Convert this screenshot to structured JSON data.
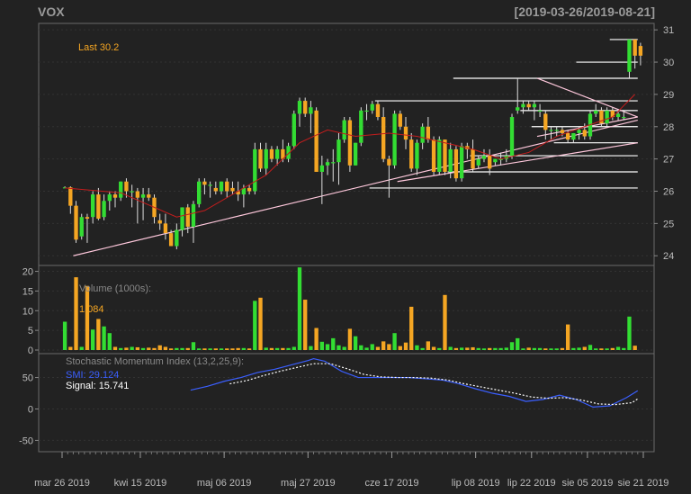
{
  "header": {
    "title": "VOX",
    "range": "[2019-03-26/2019-08-21]"
  },
  "chart_data": [
    {
      "type": "candlestick",
      "panel": "price",
      "last_label": "Last 30.2",
      "ylim": [
        23.7,
        31.2
      ],
      "yticks": [
        24,
        25,
        26,
        27,
        28,
        29,
        30,
        31
      ],
      "up_color": "#33dd33",
      "down_color": "#f5a623",
      "trading_days": 104,
      "ohlc": [
        [
          26.1,
          26.15,
          26.1,
          26.12
        ],
        [
          26.12,
          26.15,
          25.3,
          25.55
        ],
        [
          25.55,
          25.7,
          24.4,
          24.5
        ],
        [
          24.6,
          25.3,
          24.5,
          25.2
        ],
        [
          25.2,
          25.3,
          24.4,
          25.15
        ],
        [
          25.2,
          26.0,
          25.0,
          25.9
        ],
        [
          25.9,
          26.1,
          25.1,
          25.15
        ],
        [
          25.2,
          25.9,
          25.1,
          25.7
        ],
        [
          25.7,
          26.0,
          25.4,
          25.9
        ],
        [
          25.9,
          26.0,
          25.5,
          25.8
        ],
        [
          25.8,
          26.3,
          25.7,
          26.3
        ],
        [
          26.3,
          26.4,
          25.8,
          26.0
        ],
        [
          26.0,
          26.2,
          25.5,
          26.0
        ],
        [
          26.0,
          26.1,
          25.0,
          25.8
        ],
        [
          25.8,
          26.1,
          25.1,
          25.9
        ],
        [
          25.9,
          26.1,
          25.7,
          25.8
        ],
        [
          25.8,
          25.9,
          25.0,
          25.2
        ],
        [
          25.1,
          25.3,
          24.8,
          25.0
        ],
        [
          25.0,
          25.3,
          24.5,
          24.7
        ],
        [
          24.7,
          24.8,
          24.3,
          24.3
        ],
        [
          24.3,
          25.0,
          24.2,
          24.8
        ],
        [
          24.8,
          25.5,
          24.6,
          25.5
        ],
        [
          25.5,
          25.6,
          24.7,
          24.9
        ],
        [
          24.9,
          25.7,
          24.4,
          25.6
        ],
        [
          25.6,
          26.4,
          25.5,
          26.3
        ],
        [
          26.3,
          26.4,
          25.9,
          26.2
        ],
        [
          26.2,
          26.3,
          25.8,
          26.2
        ],
        [
          26.1,
          26.3,
          25.9,
          26.0
        ],
        [
          26.0,
          26.3,
          25.9,
          26.3
        ],
        [
          26.3,
          26.4,
          25.8,
          26.0
        ],
        [
          26.1,
          26.3,
          25.9,
          26.0
        ],
        [
          26.0,
          26.3,
          25.7,
          25.9
        ],
        [
          25.9,
          26.2,
          25.5,
          26.1
        ],
        [
          26.1,
          26.2,
          25.9,
          26.0
        ],
        [
          26.0,
          27.5,
          25.9,
          27.3
        ],
        [
          27.3,
          27.5,
          26.6,
          26.7
        ],
        [
          26.7,
          27.5,
          26.5,
          27.3
        ],
        [
          27.3,
          27.4,
          26.9,
          27.0
        ],
        [
          27.0,
          27.4,
          26.8,
          27.3
        ],
        [
          27.3,
          27.6,
          26.9,
          27.0
        ],
        [
          27.0,
          27.5,
          26.9,
          27.4
        ],
        [
          27.4,
          28.5,
          27.3,
          28.4
        ],
        [
          28.4,
          28.9,
          28.0,
          28.8
        ],
        [
          28.8,
          28.9,
          28.3,
          28.4
        ],
        [
          28.4,
          28.8,
          27.8,
          28.6
        ],
        [
          28.5,
          28.6,
          26.6,
          26.6
        ],
        [
          26.6,
          27.1,
          25.6,
          26.8
        ],
        [
          26.8,
          27.0,
          26.5,
          26.9
        ],
        [
          26.9,
          27.3,
          26.3,
          26.9
        ],
        [
          26.9,
          27.8,
          26.2,
          27.6
        ],
        [
          27.6,
          28.3,
          27.5,
          28.2
        ],
        [
          28.2,
          28.3,
          26.6,
          26.8
        ],
        [
          26.8,
          27.5,
          26.8,
          27.5
        ],
        [
          27.5,
          28.6,
          27.4,
          28.5
        ],
        [
          28.5,
          28.7,
          28.2,
          28.5
        ],
        [
          28.5,
          28.8,
          28.4,
          28.7
        ],
        [
          28.7,
          28.8,
          28.2,
          28.3
        ],
        [
          28.3,
          28.6,
          26.9,
          27.0
        ],
        [
          27.0,
          27.1,
          25.8,
          26.8
        ],
        [
          26.8,
          28.5,
          26.7,
          28.4
        ],
        [
          28.4,
          28.5,
          27.9,
          28.0
        ],
        [
          28.0,
          28.3,
          27.3,
          27.6
        ],
        [
          27.6,
          27.8,
          26.6,
          26.7
        ],
        [
          26.7,
          27.6,
          26.5,
          27.5
        ],
        [
          27.5,
          28.1,
          27.3,
          28.0
        ],
        [
          28.0,
          28.3,
          27.5,
          27.6
        ],
        [
          27.6,
          27.7,
          26.5,
          26.6
        ],
        [
          26.6,
          27.7,
          26.5,
          27.6
        ],
        [
          27.6,
          27.6,
          26.5,
          26.6
        ],
        [
          26.6,
          27.5,
          26.4,
          27.3
        ],
        [
          27.3,
          27.4,
          26.3,
          26.4
        ],
        [
          26.4,
          27.5,
          26.3,
          27.4
        ],
        [
          27.4,
          27.5,
          27.0,
          27.3
        ],
        [
          27.3,
          27.6,
          26.6,
          26.7
        ],
        [
          26.8,
          27.1,
          26.7,
          27.0
        ],
        [
          27.0,
          27.3,
          26.9,
          27.1
        ],
        [
          27.1,
          27.3,
          26.5,
          26.7
        ],
        [
          26.9,
          27.0,
          26.8,
          27.0
        ],
        [
          27.0,
          27.2,
          26.8,
          27.0
        ],
        [
          27.0,
          27.3,
          26.9,
          27.1
        ],
        [
          27.1,
          28.4,
          27.0,
          28.3
        ],
        [
          28.5,
          29.5,
          28.4,
          28.6
        ],
        [
          28.6,
          28.8,
          28.4,
          28.7
        ],
        [
          28.7,
          28.8,
          28.5,
          28.6
        ],
        [
          28.6,
          28.8,
          28.2,
          28.7
        ],
        [
          28.5,
          28.7,
          28.3,
          28.5
        ],
        [
          28.4,
          28.5,
          27.6,
          27.9
        ],
        [
          27.9,
          28.0,
          27.6,
          27.9
        ],
        [
          27.9,
          28.0,
          27.7,
          27.9
        ],
        [
          27.9,
          28.0,
          27.7,
          27.8
        ],
        [
          27.8,
          27.9,
          27.5,
          27.6
        ],
        [
          27.6,
          27.8,
          27.5,
          27.8
        ],
        [
          27.8,
          28.0,
          27.6,
          27.9
        ],
        [
          27.9,
          28.1,
          27.6,
          27.7
        ],
        [
          27.7,
          28.5,
          27.6,
          28.4
        ],
        [
          28.4,
          28.7,
          28.3,
          28.5
        ],
        [
          28.5,
          28.6,
          28.0,
          28.1
        ],
        [
          28.1,
          28.6,
          28.0,
          28.5
        ],
        [
          28.5,
          28.6,
          28.2,
          28.3
        ],
        [
          28.3,
          28.5,
          28.2,
          28.4
        ],
        [
          28.3,
          28.5,
          28.2,
          28.3
        ],
        [
          29.7,
          30.7,
          29.5,
          30.7
        ],
        [
          30.7,
          30.7,
          29.8,
          30.2
        ],
        [
          30.5,
          30.6,
          29.9,
          30.2
        ]
      ],
      "moving_average": [
        [
          0,
          26.1
        ],
        [
          10,
          25.95
        ],
        [
          20,
          25.2
        ],
        [
          25,
          25.4
        ],
        [
          30,
          25.9
        ],
        [
          36,
          26.5
        ],
        [
          42,
          27.5
        ],
        [
          47,
          27.9
        ],
        [
          52,
          27.7
        ],
        [
          58,
          27.8
        ],
        [
          63,
          27.7
        ],
        [
          68,
          27.5
        ],
        [
          73,
          27.3
        ],
        [
          78,
          27.0
        ],
        [
          83,
          27.2
        ],
        [
          88,
          27.7
        ],
        [
          93,
          28.0
        ],
        [
          98,
          28.3
        ],
        [
          102,
          29.0
        ]
      ],
      "trend_lines": [
        [
          [
            2,
            24.0
          ],
          [
            103,
            28.2
          ]
        ],
        [
          [
            60,
            26.3
          ],
          [
            103,
            27.5
          ]
        ],
        [
          [
            85,
            27.7
          ],
          [
            103,
            28.3
          ]
        ],
        [
          [
            85,
            29.5
          ],
          [
            103,
            28.3
          ]
        ]
      ],
      "level_lines": [
        [
          56,
          103,
          28.8
        ],
        [
          98,
          103,
          30.7
        ],
        [
          92,
          103,
          30.0
        ],
        [
          70,
          103,
          29.5
        ],
        [
          82,
          103,
          28.5
        ],
        [
          84,
          103,
          28.0
        ],
        [
          88,
          103,
          27.5
        ],
        [
          73,
          103,
          27.1
        ],
        [
          69,
          103,
          26.6
        ],
        [
          55,
          103,
          26.1
        ]
      ]
    },
    {
      "type": "bar",
      "panel": "volume",
      "title": "Volume (1000s):",
      "last_value": "1,084",
      "ylim": [
        0,
        21.5
      ],
      "yticks": [
        0,
        5,
        10,
        15,
        20
      ],
      "values": [
        7.2,
        0.8,
        18.5,
        0.8,
        16.3,
        5.2,
        7.9,
        6.0,
        4.3,
        0.8,
        0.5,
        0.6,
        0.8,
        0.7,
        0.5,
        0.6,
        0.5,
        1.2,
        0.8,
        0.4,
        0.5,
        0.5,
        0.5,
        2.0,
        0.4,
        0.4,
        0.4,
        0.4,
        0.4,
        0.4,
        0.4,
        0.5,
        0.5,
        0.4,
        12.5,
        13.3,
        0.6,
        0.5,
        0.5,
        0.5,
        0.5,
        0.8,
        21.0,
        12.8,
        1.0,
        5.6,
        2.1,
        1.5,
        3.0,
        1.2,
        0.8,
        5.4,
        3.5,
        1.2,
        0.6,
        1.5,
        0.8,
        2.2,
        1.5,
        4.3,
        1.0,
        1.9,
        11.0,
        1.2,
        0.5,
        2.2,
        0.8,
        0.5,
        14.0,
        0.8,
        0.5,
        0.6,
        0.6,
        0.7,
        0.5,
        0.4,
        0.5,
        0.5,
        0.5,
        0.6,
        2.0,
        3.0,
        0.4,
        0.6,
        0.5,
        0.5,
        0.4,
        0.4,
        0.4,
        0.5,
        6.5,
        0.5,
        0.6,
        0.8,
        1.3,
        0.4,
        0.4,
        0.4,
        0.5,
        0.8,
        0.5,
        8.5,
        1.1
      ]
    },
    {
      "type": "line",
      "panel": "smi",
      "title": "Stochastic Momentum Index (13,2,25,9):",
      "ylim": [
        -68,
        88
      ],
      "yticks": [
        -50,
        0,
        50
      ],
      "series": [
        {
          "name": "SMI",
          "label": "SMI: 29.124",
          "color": "#3b5fff",
          "points": [
            [
              23,
              30
            ],
            [
              26,
              36
            ],
            [
              29,
              44
            ],
            [
              32,
              50
            ],
            [
              35,
              58
            ],
            [
              38,
              63
            ],
            [
              41,
              70
            ],
            [
              44,
              77
            ],
            [
              45,
              80
            ],
            [
              47,
              76
            ],
            [
              50,
              60
            ],
            [
              53,
              50
            ],
            [
              56,
              50
            ],
            [
              59,
              50
            ],
            [
              62,
              50
            ],
            [
              65,
              48
            ],
            [
              68,
              46
            ],
            [
              71,
              40
            ],
            [
              74,
              32
            ],
            [
              77,
              25
            ],
            [
              80,
              20
            ],
            [
              83,
              12
            ],
            [
              86,
              15
            ],
            [
              89,
              22
            ],
            [
              92,
              15
            ],
            [
              95,
              3
            ],
            [
              98,
              5
            ],
            [
              101,
              18
            ],
            [
              103,
              29
            ]
          ]
        },
        {
          "name": "Signal",
          "label": "Signal: 15.741",
          "color": "#ffffff",
          "points": [
            [
              30,
              40
            ],
            [
              33,
              45
            ],
            [
              36,
              53
            ],
            [
              39,
              60
            ],
            [
              42,
              66
            ],
            [
              45,
              72
            ],
            [
              48,
              72
            ],
            [
              51,
              64
            ],
            [
              54,
              55
            ],
            [
              57,
              51
            ],
            [
              60,
              50
            ],
            [
              63,
              50
            ],
            [
              66,
              49
            ],
            [
              69,
              46
            ],
            [
              72,
              40
            ],
            [
              75,
              35
            ],
            [
              78,
              30
            ],
            [
              81,
              25
            ],
            [
              84,
              19
            ],
            [
              87,
              17
            ],
            [
              90,
              18
            ],
            [
              93,
              14
            ],
            [
              96,
              8
            ],
            [
              99,
              7
            ],
            [
              102,
              10
            ],
            [
              103,
              16
            ]
          ]
        }
      ]
    }
  ],
  "x_axis": {
    "labels": [
      "mar 26 2019",
      "kwi 15 2019",
      "maj 06 2019",
      "maj 27 2019",
      "cze 17 2019",
      "lip 08 2019",
      "lip 22 2019",
      "sie 05 2019",
      "sie 21 2019"
    ],
    "label_days": [
      0,
      14,
      29,
      44,
      59,
      74,
      84,
      94,
      104
    ]
  }
}
